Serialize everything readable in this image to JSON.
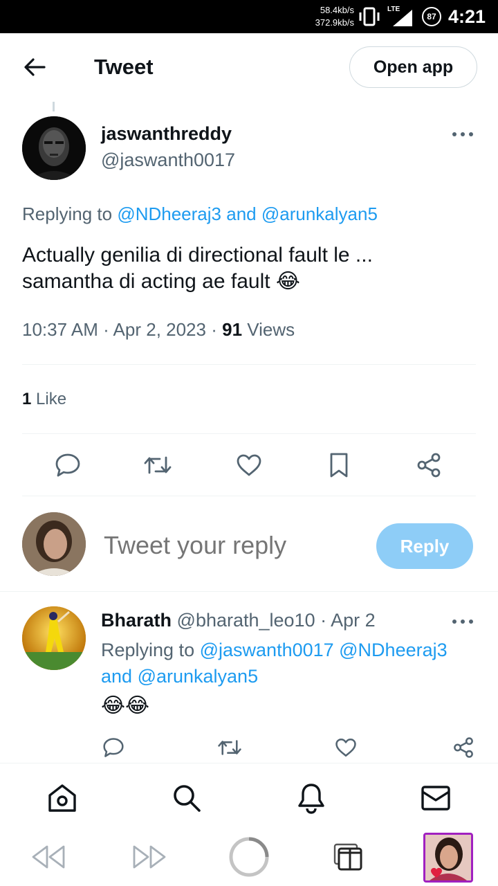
{
  "status_bar": {
    "speed_down": "58.4kb/s",
    "speed_up": "372.9kb/s",
    "network": "LTE",
    "battery": "87",
    "time": "4:21"
  },
  "header": {
    "title": "Tweet",
    "open_app": "Open app"
  },
  "tweet": {
    "author_name": "jaswanthreddy",
    "author_handle": "@jaswanth0017",
    "replying_prefix": "Replying to",
    "replying_user1": "@NDheeraj3",
    "replying_and": "and",
    "replying_user2": "@arunkalyan5",
    "text_line1": "Actually genilia di directional fault le ...",
    "text_line2": "samantha di acting ae fault",
    "emoji": "😂",
    "time": "10:37 AM",
    "date": "Apr 2, 2023",
    "views_count": "91",
    "views_label": "Views",
    "likes_count": "1",
    "likes_label": "Like"
  },
  "compose": {
    "placeholder": "Tweet your reply",
    "reply_button": "Reply"
  },
  "reply": {
    "name": "Bharath",
    "handle": "@bharath_leo10",
    "date": "Apr 2",
    "replying_prefix": "Replying to",
    "replying_users_line1": "@jaswanth0017 @NDheeraj3",
    "replying_and": "and",
    "replying_user_last": "@arunkalyan5",
    "text": "😂😂"
  },
  "colors": {
    "accent": "#1d9bf0",
    "reply_button_bg": "#8ecdf7",
    "secondary_text": "#536471",
    "divider": "#eff3f4"
  }
}
